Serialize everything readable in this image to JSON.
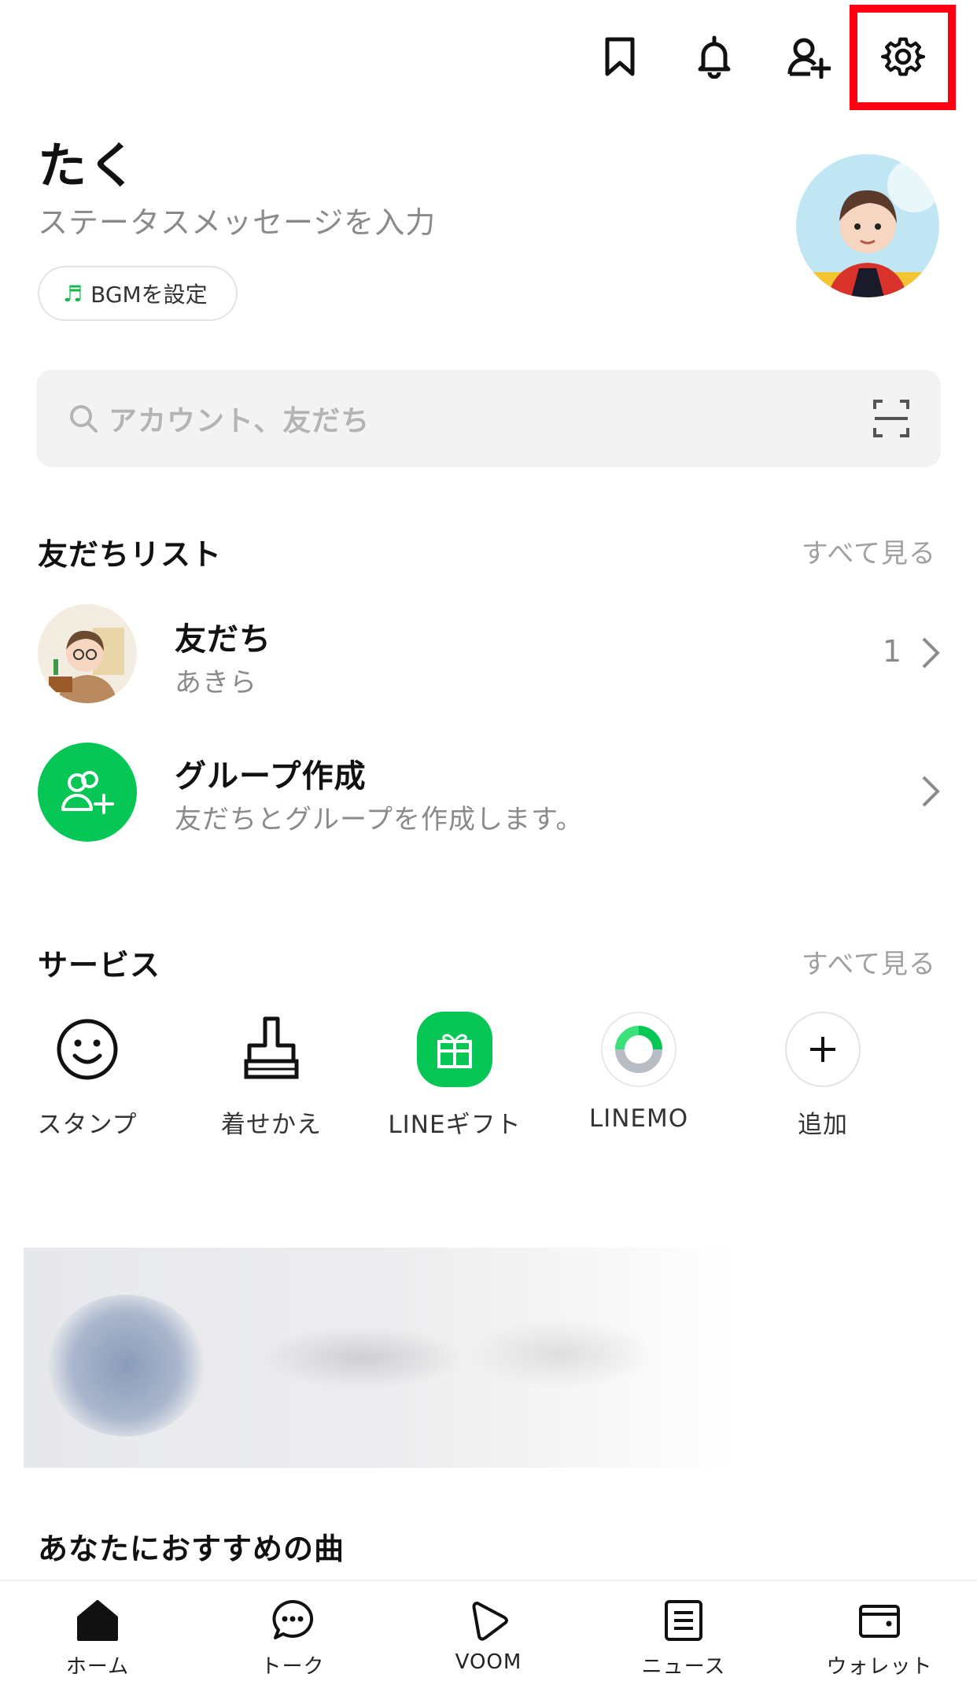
{
  "profile": {
    "name": "たく",
    "status_placeholder": "ステータスメッセージを入力",
    "bgm_label": "BGMを設定"
  },
  "search": {
    "placeholder": "アカウント、友だち"
  },
  "friends_section": {
    "title": "友だちリスト",
    "see_all": "すべて見る",
    "items": [
      {
        "title": "友だち",
        "subtitle": "あきら",
        "count": "1"
      },
      {
        "title": "グループ作成",
        "subtitle": "友だちとグループを作成します。"
      }
    ]
  },
  "services_section": {
    "title": "サービス",
    "see_all": "すべて見る",
    "items": [
      {
        "label": "スタンプ",
        "icon": "smile-icon"
      },
      {
        "label": "着せかえ",
        "icon": "brush-icon"
      },
      {
        "label": "LINEギフト",
        "icon": "gift-icon"
      },
      {
        "label": "LINEMO",
        "icon": "linemo-icon"
      },
      {
        "label": "追加",
        "icon": "plus-icon"
      }
    ]
  },
  "recommend": {
    "title": "あなたにおすすめの曲"
  },
  "tabs": [
    {
      "label": "ホーム",
      "icon": "home-icon"
    },
    {
      "label": "トーク",
      "icon": "chat-icon"
    },
    {
      "label": "VOOM",
      "icon": "voom-icon"
    },
    {
      "label": "ニュース",
      "icon": "news-icon"
    },
    {
      "label": "ウォレット",
      "icon": "wallet-icon"
    }
  ],
  "colors": {
    "accent_green": "#06c755",
    "highlight_red": "#ff0012"
  }
}
